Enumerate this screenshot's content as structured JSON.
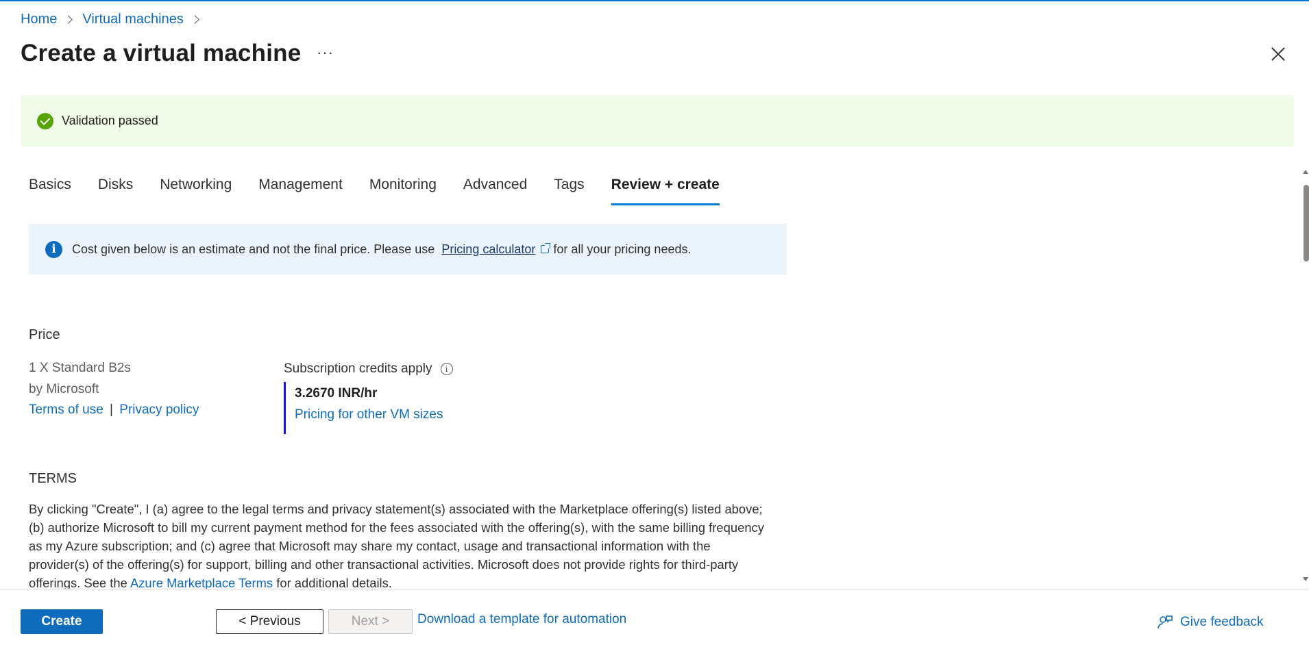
{
  "breadcrumb": {
    "home": "Home",
    "virtual_machines": "Virtual machines"
  },
  "header": {
    "title": "Create a virtual machine",
    "more": "···"
  },
  "validation": {
    "message": "Validation passed",
    "color": "#57a300"
  },
  "tabs": [
    {
      "label": "Basics"
    },
    {
      "label": "Disks"
    },
    {
      "label": "Networking"
    },
    {
      "label": "Management"
    },
    {
      "label": "Monitoring"
    },
    {
      "label": "Advanced"
    },
    {
      "label": "Tags"
    },
    {
      "label": "Review + create",
      "active": true
    }
  ],
  "info": {
    "text_before": "Cost given below is an estimate and not the final price. Please use",
    "link": "Pricing calculator",
    "text_after": "for all your pricing needs."
  },
  "price": {
    "heading": "Price",
    "sku": "1 X Standard B2s",
    "publisher": "by Microsoft",
    "terms_of_use": "Terms of use",
    "separator": "|",
    "privacy_policy": "Privacy policy",
    "credits_label": "Subscription credits apply",
    "rate": "3.2670 INR/hr",
    "other_sizes": "Pricing for other VM sizes"
  },
  "terms": {
    "heading": "TERMS",
    "body": "By clicking \"Create\", I (a) agree to the legal terms and privacy statement(s) associated with the Marketplace offering(s) listed above; (b) authorize Microsoft to bill my current payment method for the fees associated with the offering(s), with the same billing frequency as my Azure subscription; and (c) agree that Microsoft may share my contact, usage and transactional information with the provider(s) of the offering(s) for support, billing and other transactional activities. Microsoft does not provide rights for third-party offerings. See the",
    "link": "Azure Marketplace Terms",
    "tail": "for additional details."
  },
  "footer": {
    "create": "Create",
    "previous": "< Previous",
    "next": "Next >",
    "download": "Download a template for automation",
    "feedback": "Give feedback"
  },
  "colors": {
    "accent": "#0078d4",
    "link": "#0f6cbd",
    "info_bg": "#ebf3fc",
    "validation_bg": "#f1fbe9"
  }
}
